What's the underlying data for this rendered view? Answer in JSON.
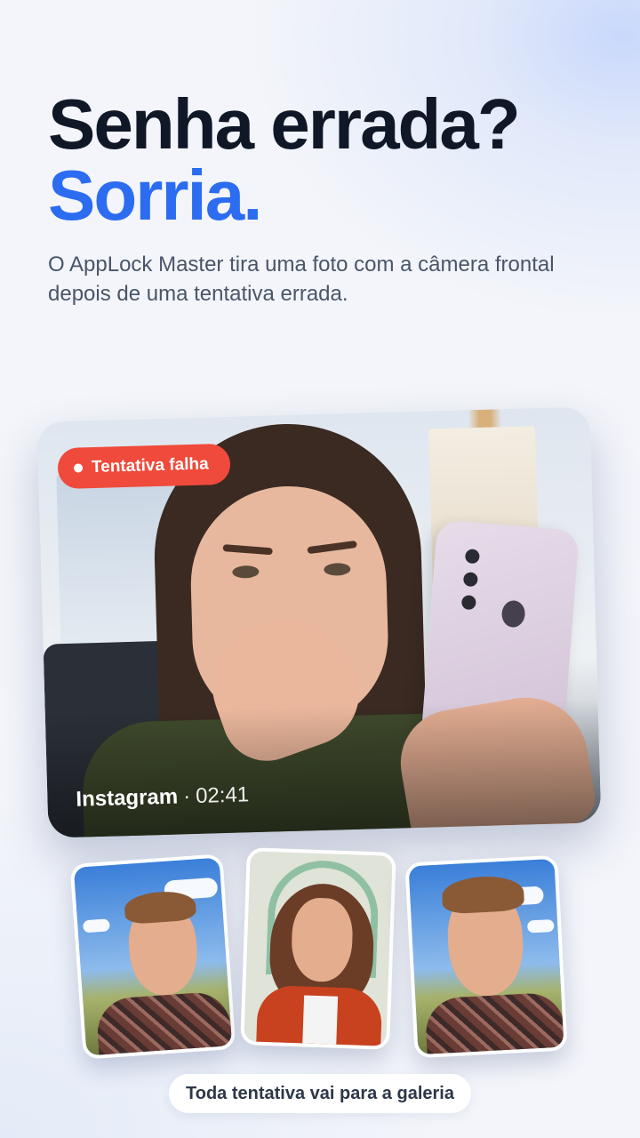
{
  "headline": {
    "line1": "Senha errada?",
    "line2": "Sorria."
  },
  "subtitle": "O AppLock Master tira uma foto com a câmera frontal depois de uma tentativa errada.",
  "main_card": {
    "badge": "Tentativa falha",
    "app_name": "Instagram",
    "separator": "·",
    "time": "02:41"
  },
  "thumbnails": [
    "man-smiling-outdoors-photo",
    "woman-selfie-photo",
    "man-talking-outdoors-photo"
  ],
  "gallery_pill": "Toda tentativa vai para a galeria",
  "colors": {
    "headline_dark": "#101828",
    "accent_blue": "#2b6cf0",
    "badge_red": "#ef4a3b",
    "subtitle_gray": "#4a5568"
  }
}
